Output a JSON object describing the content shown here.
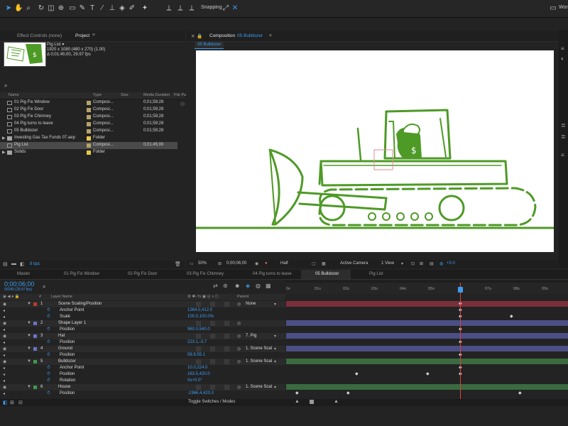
{
  "toolbar": {
    "snapping_label": "Snapping",
    "workspace_label": "Wor"
  },
  "left_panel": {
    "tabs": [
      "Effect Controls (none)",
      "Project"
    ],
    "preview": {
      "name": "Pig List ▾",
      "size": "1920 x 1080  (480 x 270) (1.00)",
      "duration": "Δ 0;01;45;00, 29.97 fps"
    },
    "columns": [
      "Name",
      "Type",
      "Size",
      "Media Duration",
      "File Pa"
    ],
    "items": [
      {
        "name": "01 Pig Fix Window",
        "type": "Composi...",
        "duration": "0;01;59;28",
        "label_color": "#b5a36a"
      },
      {
        "name": "02 Pig Fix Door",
        "type": "Composi...",
        "duration": "0;01;59;28",
        "label_color": "#b5a36a"
      },
      {
        "name": "03 Pig Fix Chimney",
        "type": "Composi...",
        "duration": "0;01;59;28",
        "label_color": "#b5a36a"
      },
      {
        "name": "04 Pig turns to leave",
        "type": "Composi...",
        "duration": "0;01;59;28",
        "label_color": "#b5a36a"
      },
      {
        "name": "05 Bulldozer",
        "type": "Composi...",
        "duration": "0;01;59;28",
        "label_color": "#b5a36a"
      },
      {
        "name": "Investing Gas Tax Funds 07.aep",
        "type": "Folder",
        "duration": "",
        "label_color": "#e6c84a"
      },
      {
        "name": "Pig List",
        "type": "Composi...",
        "duration": "0;01;45;00",
        "label_color": "#b5a36a"
      },
      {
        "name": "Solids",
        "type": "Folder",
        "duration": "",
        "label_color": "#e6c84a"
      }
    ],
    "bpc": "8 bpc"
  },
  "comp_panel": {
    "title_prefix": "Composition",
    "title_name": "05 Bulldozer",
    "sub_tab": "05 Bulldozer",
    "footer": {
      "zoom": "50%",
      "timecode": "0;00;06;00",
      "resolution": "Half",
      "camera": "Active Camera",
      "views": "1 View",
      "exposure": "+0.0"
    }
  },
  "timeline": {
    "tabs": [
      "Master",
      "01 Pig Fix Window",
      "02 Pig Fix Door",
      "03 Pig Fix Chimney",
      "04 Pig turns to leave",
      "05 Bulldozer",
      "Pig List"
    ],
    "selected_tab": "05 Bulldozer",
    "timecode": "0;00;06;00",
    "timecode_sub": "00180 (29.97 fps)",
    "header": {
      "hash": "#",
      "layer_name": "Layer Name",
      "parent": "Parent"
    },
    "ruler": [
      "0s",
      "01s",
      "02s",
      "03s",
      "04s",
      "05s",
      "07s",
      "08s",
      "09s"
    ],
    "rows": [
      {
        "kind": "layer",
        "num": "1",
        "name": "Scene Scaling/Position",
        "parent": "None",
        "color": "#c0392b",
        "bar": "#7a2f3a"
      },
      {
        "kind": "prop",
        "name": "Anchor Point",
        "value": "1364.0,412.0",
        "bar": "#232323"
      },
      {
        "kind": "prop",
        "name": "Scale",
        "value": "100.0,100.0%",
        "bar": "#232323"
      },
      {
        "kind": "layer",
        "num": "2",
        "name": "Shape Layer 1",
        "parent": "",
        "color": "#6c72c8",
        "bar": "#4b4f86"
      },
      {
        "kind": "prop",
        "name": "Position",
        "value": "960.0,540.0",
        "bar": "#232323"
      },
      {
        "kind": "layer",
        "num": "3",
        "name": "Hat",
        "parent": "7. Pig",
        "color": "#6c72c8",
        "bar": "#4b4f86"
      },
      {
        "kind": "prop",
        "name": "Position",
        "value": "223.1,-3.7",
        "bar": "#232323"
      },
      {
        "kind": "layer",
        "num": "4",
        "name": "Ground",
        "parent": "1. Scene Scal",
        "color": "#6c72c8",
        "bar": "#4b4f86"
      },
      {
        "kind": "prop",
        "name": "Position",
        "value": "58.9,55.1",
        "bar": "#232323"
      },
      {
        "kind": "layer",
        "num": "5",
        "name": "Bulldozer",
        "parent": "1. Scene Scal",
        "color": "#3f9a4a",
        "bar": "#3b6a40"
      },
      {
        "kind": "prop",
        "name": "Anchor Point",
        "value": "10.0,224.0",
        "bar": "#232323"
      },
      {
        "kind": "prop",
        "name": "Position",
        "value": "163.5,420.0",
        "bar": "#232323"
      },
      {
        "kind": "prop",
        "name": "Rotation",
        "value": "0x+0.0°",
        "bar": "#232323"
      },
      {
        "kind": "layer",
        "num": "6",
        "name": "House",
        "parent": "1. Scene Scal",
        "color": "#3f9a4a",
        "bar": "#3b6a40"
      },
      {
        "kind": "prop",
        "name": "Position",
        "value": "-1966.4,420.0",
        "bar": "#232323"
      }
    ],
    "toggle_label": "Toggle Switches / Modes"
  },
  "colors": {
    "accent": "#3d9cf0",
    "bulldozer_green": "#4e9a26",
    "playhead": "#e04040"
  }
}
